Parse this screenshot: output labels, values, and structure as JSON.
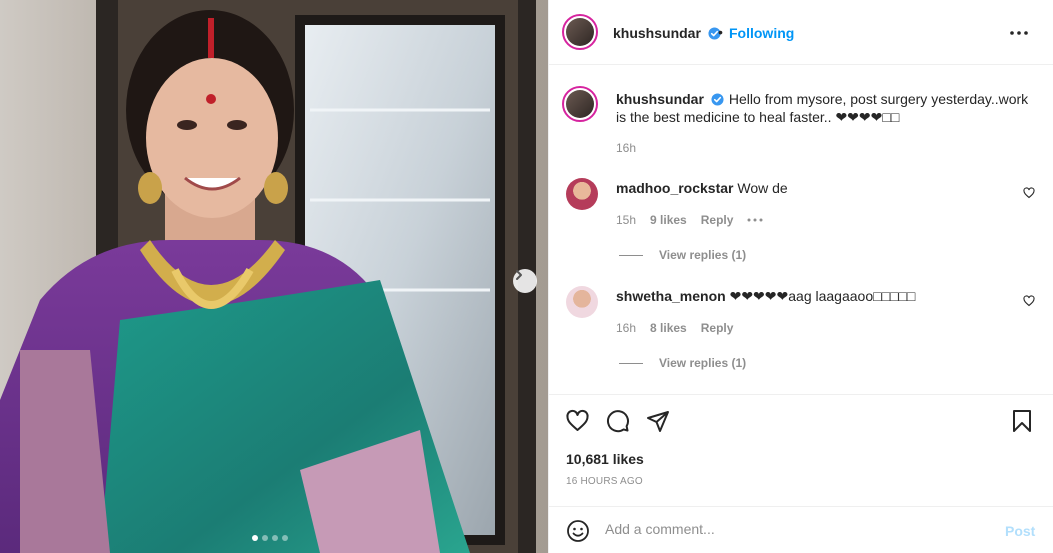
{
  "post": {
    "username": "khushsundar",
    "follow_status": "Following",
    "separator": "•",
    "caption": "Hello from mysore, post surgery yesterday..work is the best medicine to heal faster.. ❤❤❤❤□□",
    "caption_time": "16h",
    "likes": "10,681 likes",
    "posted": "16 HOURS AGO",
    "carousel": {
      "total_slides": 4,
      "active_slide": 1
    }
  },
  "comments": [
    {
      "username": "madhoo_rockstar",
      "text": "Wow de",
      "time": "15h",
      "likes": "9 likes",
      "reply_label": "Reply",
      "view_replies": "View replies (1)"
    },
    {
      "username": "shwetha_menon",
      "text": "❤❤❤❤❤aag laagaaoo□□□□□",
      "time": "16h",
      "likes": "8 likes",
      "reply_label": "Reply",
      "view_replies": "View replies (1)"
    }
  ],
  "composer": {
    "placeholder": "Add a comment...",
    "post_label": "Post"
  },
  "icons": {
    "verified": "verified-badge-icon",
    "more": "more-options-icon",
    "heart": "heart-icon",
    "comment": "comment-icon",
    "share": "share-icon",
    "save": "bookmark-icon",
    "emoji": "emoji-icon",
    "next": "chevron-right-icon"
  },
  "colors": {
    "accent": "#0095f6",
    "verified": "#3897f0",
    "muted": "#8e8e8e",
    "text": "#262626",
    "post_disabled": "#b2dffc"
  }
}
